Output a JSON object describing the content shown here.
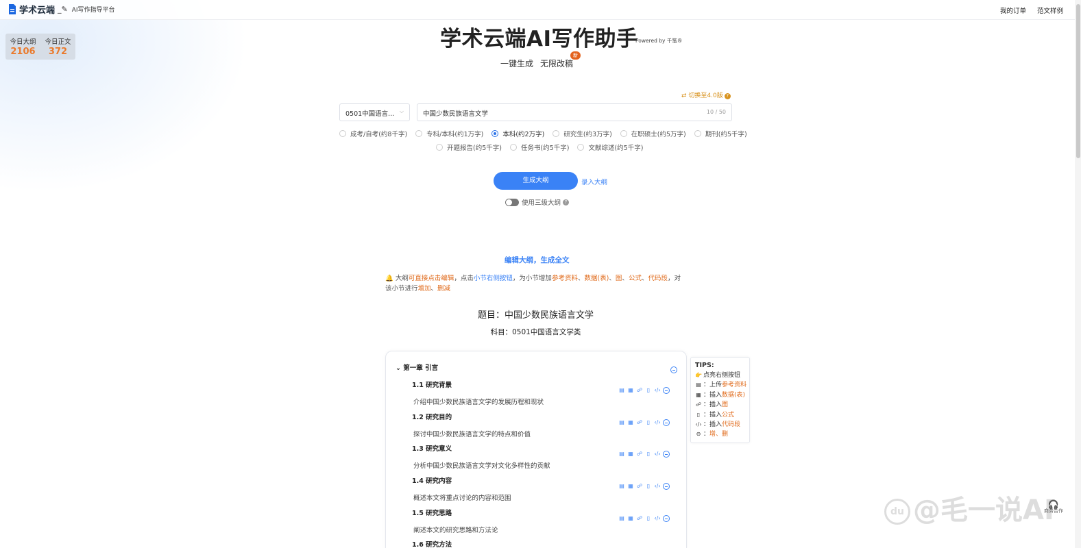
{
  "header": {
    "brand_name": "学术云端",
    "brand_sub": "AI写作指导平台",
    "nav": [
      "我的订单",
      "范文样例"
    ]
  },
  "stats": {
    "outline_label": "今日大纲",
    "outline_value": "2106",
    "body_label": "今日正文",
    "body_value": "372"
  },
  "hero": {
    "title": "学术云端AI写作助手",
    "powered": "Powered by 千笔®",
    "sub1": "一键生成",
    "sub2": "无限改稿",
    "new_badge": "新"
  },
  "form": {
    "switch_version": "⇄ 切换至4.0版",
    "subject_value": "0501中国语言...",
    "topic_value": "中国少数民族语言文学",
    "topic_count": "10 / 50",
    "levels_row1": [
      {
        "label": "成考/自考(约8千字)",
        "selected": false
      },
      {
        "label": "专科/本科(约1万字)",
        "selected": false
      },
      {
        "label": "本科(约2万字)",
        "selected": true
      },
      {
        "label": "研究生(约3万字)",
        "selected": false
      },
      {
        "label": "在职硕士(约5万字)",
        "selected": false
      },
      {
        "label": "期刊(约5千字)",
        "selected": false
      }
    ],
    "levels_row2": [
      {
        "label": "开题报告(约5千字)",
        "selected": false
      },
      {
        "label": "任务书(约5千字)",
        "selected": false
      },
      {
        "label": "文献综述(约5千字)",
        "selected": false
      }
    ],
    "generate_label": "生成大纲",
    "import_label": "录入大纲",
    "toggle_label": "使用三级大纲",
    "toggle_on": false
  },
  "editor": {
    "title": "编辑大纲，生成全文",
    "notice": {
      "icon": "🔔",
      "p1": " 大纲",
      "p2": "可直接点击编辑",
      "p3": "，点击",
      "p4": "小节右侧按钮",
      "p5": "，为小节增加",
      "p6": "参考资料",
      "p7": "、",
      "p8": "数据(表)",
      "p9": "、",
      "p10": "图",
      "p11": "、",
      "p12": "公式",
      "p13": "、",
      "p14": "代码段",
      "p15": "，对该小节进行",
      "p16": "增加",
      "p17": "、",
      "p18": "删减"
    },
    "paper_title": "题目：中国少数民族语言文学",
    "paper_subject": "科目：0501中国语言文学类",
    "chapter": "第一章  引言",
    "sections": [
      {
        "title": "1.1  研究背景",
        "desc": "介绍中国少数民族语言文学的发展历程和现状"
      },
      {
        "title": "1.2  研究目的",
        "desc": "探讨中国少数民族语言文学的特点和价值"
      },
      {
        "title": "1.3  研究意义",
        "desc": "分析中国少数民族语言文学对文化多样性的贡献"
      },
      {
        "title": "1.4  研究内容",
        "desc": "概述本文将重点讨论的内容和范围"
      },
      {
        "title": "1.5  研究思路",
        "desc": "阐述本文的研究思路和方法论"
      },
      {
        "title": "1.6  研究方法",
        "desc": ""
      }
    ]
  },
  "tips": {
    "title": "TIPS:",
    "intro": "点亮右侧按钮",
    "lines": [
      {
        "icon": "upload-doc-icon",
        "pre": "：上传",
        "hl": "参考资料"
      },
      {
        "icon": "table-icon",
        "pre": "：插入",
        "hl": "数据(表)"
      },
      {
        "icon": "diagram-icon",
        "pre": "：插入",
        "hl": "图"
      },
      {
        "icon": "formula-icon",
        "pre": "：插入",
        "hl": "公式"
      },
      {
        "icon": "code-icon",
        "pre": "：插入",
        "hl": "代码段"
      },
      {
        "icon": "minus-circle-icon",
        "pre": "：",
        "hl": "增、删"
      }
    ]
  },
  "watermark": "@毛一说AI",
  "customer_service": "商务合作",
  "colors": {
    "accent": "#3a82f6",
    "orange": "#e06a1a",
    "stat_orange": "#ea7a2c",
    "badge": "#e3621d"
  }
}
